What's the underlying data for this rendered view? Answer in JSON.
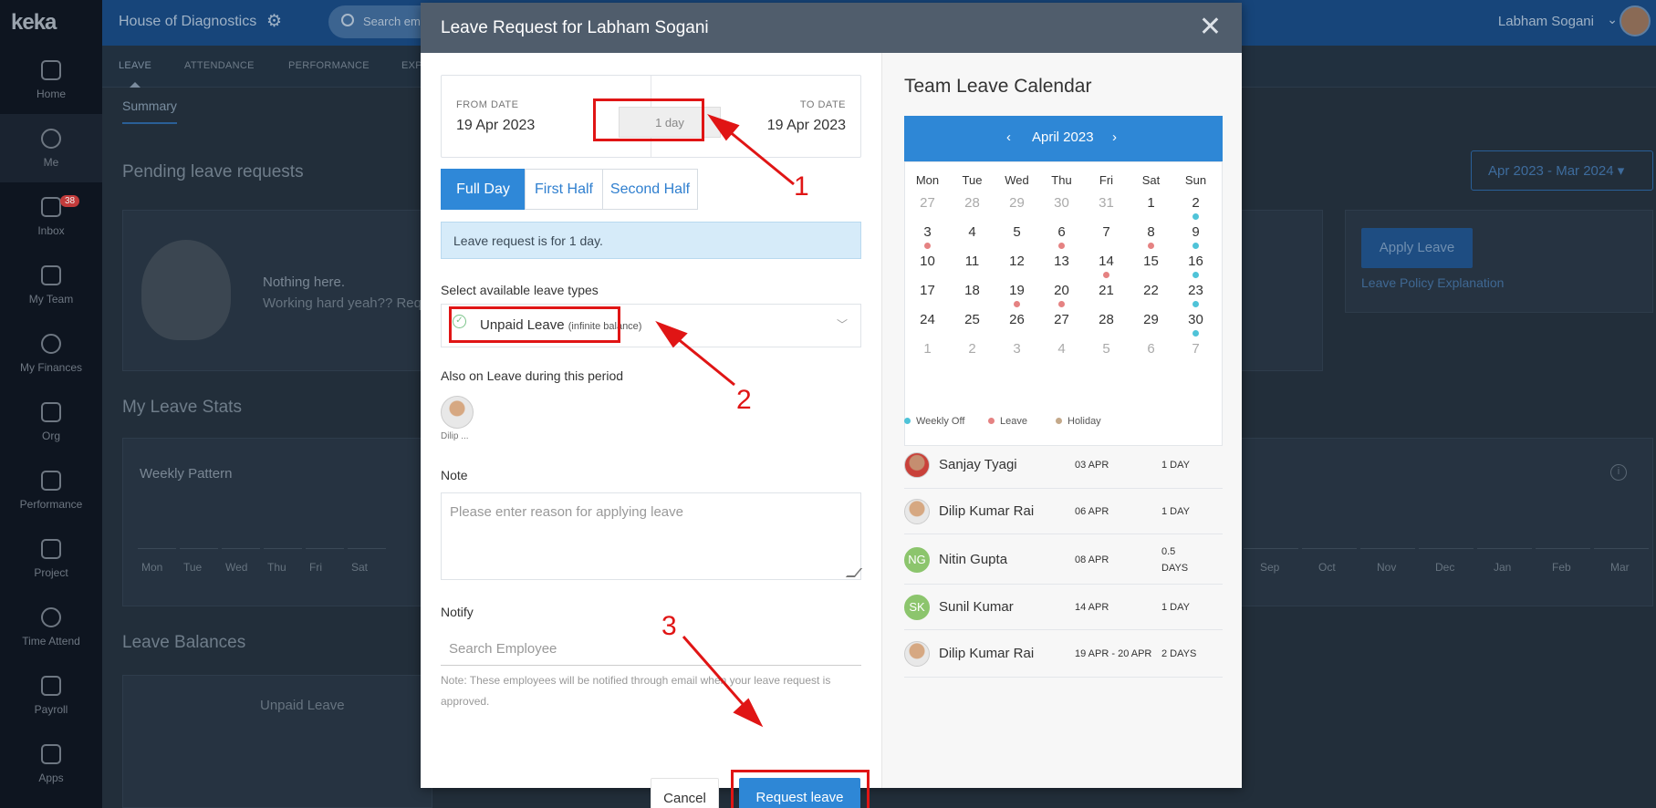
{
  "app": {
    "logo": "keka",
    "company": "House of Diagnostics",
    "search_placeholder": "Search em",
    "user_name": "Labham Sogani"
  },
  "sidebar": {
    "items": [
      {
        "label": "Home",
        "icon": "home-icon"
      },
      {
        "label": "Me",
        "icon": "user-icon"
      },
      {
        "label": "Inbox",
        "icon": "inbox-icon",
        "badge": "38"
      },
      {
        "label": "My Team",
        "icon": "team-icon"
      },
      {
        "label": "My Finances",
        "icon": "rupee-icon"
      },
      {
        "label": "Org",
        "icon": "org-icon"
      },
      {
        "label": "Performance",
        "icon": "trend-icon"
      },
      {
        "label": "Project",
        "icon": "clipboard-icon"
      },
      {
        "label": "Time Attend",
        "icon": "clock-icon"
      },
      {
        "label": "Payroll",
        "icon": "payroll-icon"
      },
      {
        "label": "Apps",
        "icon": "grid-icon"
      }
    ]
  },
  "subnav": {
    "tabs": [
      "LEAVE",
      "ATTENDANCE",
      "PERFORMANCE",
      "EXP"
    ]
  },
  "page": {
    "summary_tab": "Summary",
    "pending_title": "Pending leave requests",
    "nothing_here": "Nothing here.",
    "working_hard": "Working hard yeah?? Reque",
    "year_range": "Apr 2023 - Mar 2024",
    "apply_leave": "Apply Leave",
    "leave_policy": "Leave Policy Explanation",
    "stats_title": "My Leave Stats",
    "weekly_pattern": "Weekly Pattern",
    "weekdays": [
      "Mon",
      "Tue",
      "Wed",
      "Thu",
      "Fri",
      "Sat"
    ],
    "months": [
      "Sep",
      "Oct",
      "Nov",
      "Dec",
      "Jan",
      "Feb",
      "Mar"
    ],
    "balances_title": "Leave Balances",
    "unpaid_leave": "Unpaid Leave"
  },
  "modal": {
    "title": "Leave Request for Labham Sogani",
    "from_label": "FROM DATE",
    "from_value": "19 Apr 2023",
    "to_label": "TO DATE",
    "to_value": "19 Apr 2023",
    "days_pill": "1 day",
    "segments": [
      "Full Day",
      "First Half",
      "Second Half"
    ],
    "info": "Leave request is for 1 day.",
    "leave_types_label": "Select available leave types",
    "leave_type": "Unpaid Leave",
    "leave_type_note": "(infinite balance)",
    "also_on_leave_label": "Also on Leave during this period",
    "also_on_leave_name": "Dilip ...",
    "note_label": "Note",
    "note_placeholder": "Please enter reason for applying leave",
    "notify_label": "Notify",
    "notify_placeholder": "Search Employee",
    "notify_note": "Note: These employees will be notified through email when your leave request is approved.",
    "cancel": "Cancel",
    "submit": "Request leave"
  },
  "calendar": {
    "title": "Team Leave Calendar",
    "month": "April 2023",
    "dow": [
      "Mon",
      "Tue",
      "Wed",
      "Thu",
      "Fri",
      "Sat",
      "Sun"
    ],
    "weeks": [
      [
        "27",
        "28",
        "29",
        "30",
        "31",
        "1",
        "2"
      ],
      [
        "3",
        "4",
        "5",
        "6",
        "7",
        "8",
        "9"
      ],
      [
        "10",
        "11",
        "12",
        "13",
        "14",
        "15",
        "16"
      ],
      [
        "17",
        "18",
        "19",
        "20",
        "21",
        "22",
        "23"
      ],
      [
        "24",
        "25",
        "26",
        "27",
        "28",
        "29",
        "30"
      ],
      [
        "1",
        "2",
        "3",
        "4",
        "5",
        "6",
        "7"
      ]
    ],
    "legend": [
      "Weekly Off",
      "Leave",
      "Holiday"
    ],
    "colors": {
      "weekly_off": "#4fc3d8",
      "leave": "#e58282",
      "holiday": "#c4a98a",
      "accent": "#2e87d6"
    },
    "entries": [
      {
        "name": "Sanjay Tyagi",
        "date": "03 APR",
        "days": "1 DAY",
        "avatar": "photo-red"
      },
      {
        "name": "Dilip Kumar Rai",
        "date": "06 APR",
        "days": "1 DAY",
        "avatar": "photo"
      },
      {
        "name": "Nitin Gupta",
        "date": "08 APR",
        "days": "0.5 DAYS",
        "avatar": "NG"
      },
      {
        "name": "Sunil Kumar",
        "date": "14 APR",
        "days": "1 DAY",
        "avatar": "SK"
      },
      {
        "name": "Dilip Kumar Rai",
        "date": "19 APR - 20 APR",
        "days": "2 DAYS",
        "avatar": "photo"
      }
    ]
  },
  "annotations": [
    "1",
    "2",
    "3"
  ]
}
